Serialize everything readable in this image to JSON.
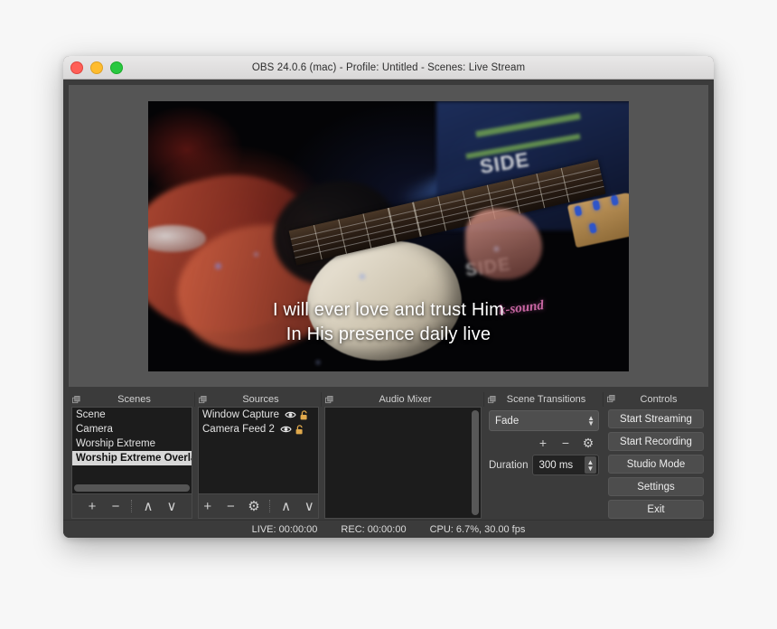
{
  "window": {
    "title": "OBS 24.0.6 (mac) - Profile: Untitled - Scenes: Live Stream",
    "traffic_lights": {
      "close": "close-button",
      "minimize": "minimize-button",
      "maximize": "maximize-button"
    }
  },
  "preview": {
    "lyrics_line1": "I will ever love and trust Him",
    "lyrics_line2": "In His presence daily live",
    "watermark": "k-sound",
    "shirt_text_1": "SIDE",
    "shirt_text_2": "SIDE"
  },
  "docks": {
    "scenes": {
      "title": "Scenes",
      "items": [
        {
          "label": "Scene",
          "selected": false
        },
        {
          "label": "Camera",
          "selected": false
        },
        {
          "label": "Worship Extreme",
          "selected": false
        },
        {
          "label": "Worship Extreme Overlay",
          "selected": true
        }
      ],
      "toolbar": {
        "add": "+",
        "remove": "−",
        "move_up": "∧",
        "move_down": "∨"
      }
    },
    "sources": {
      "title": "Sources",
      "items": [
        {
          "label": "Window Capture",
          "visible": true,
          "locked": false
        },
        {
          "label": "Camera Feed 2",
          "visible": true,
          "locked": false
        }
      ],
      "toolbar": {
        "add": "+",
        "remove": "−",
        "properties": "⚙",
        "move_up": "∧",
        "move_down": "∨"
      }
    },
    "audio_mixer": {
      "title": "Audio Mixer",
      "channels": []
    },
    "scene_transitions": {
      "title": "Scene Transitions",
      "selected_transition": "Fade",
      "duration_label": "Duration",
      "duration_value": "300 ms",
      "toolbar": {
        "add": "+",
        "remove": "−",
        "properties": "⚙"
      }
    },
    "controls": {
      "title": "Controls",
      "buttons": [
        {
          "label": "Start Streaming"
        },
        {
          "label": "Start Recording"
        },
        {
          "label": "Studio Mode"
        },
        {
          "label": "Settings"
        },
        {
          "label": "Exit"
        }
      ]
    }
  },
  "statusbar": {
    "live": "LIVE: 00:00:00",
    "rec": "REC: 00:00:00",
    "cpu": "CPU: 6.7%, 30.00 fps"
  }
}
